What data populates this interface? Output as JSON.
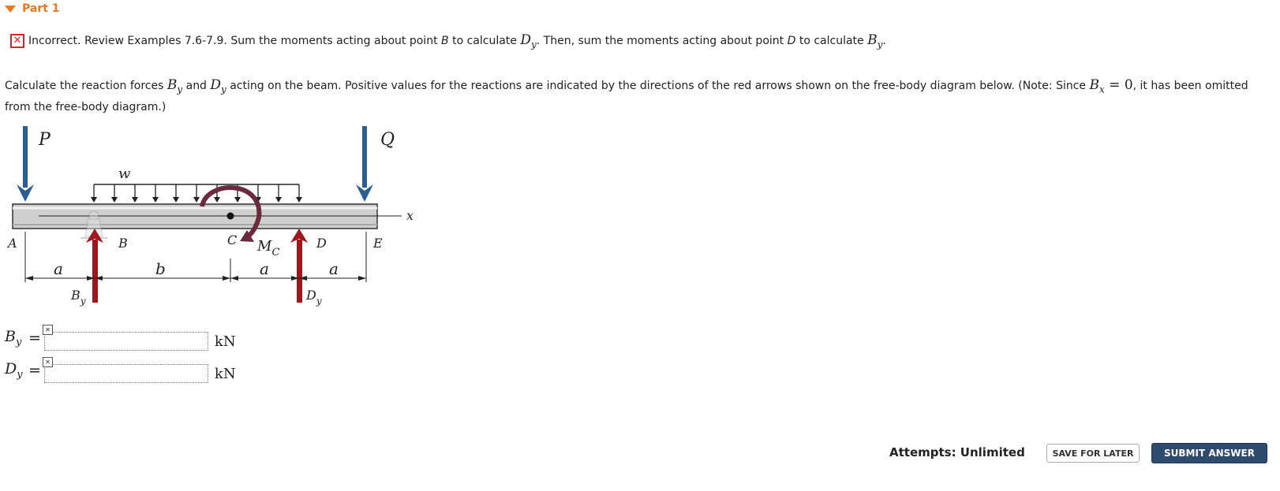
{
  "part": {
    "title": "Part 1"
  },
  "feedback": {
    "status_label": "Incorrect.",
    "review_text": "Review Examples 7.6-7.9.",
    "text_a": "Sum the moments acting about point",
    "point_b": "B",
    "text_b": "to calculate",
    "dy_base": "D",
    "dy_sub": "y",
    "text_c": ". Then, sum the moments acting about point",
    "point_d": "D",
    "text_d": "to calculate",
    "by_base": "B",
    "by_sub": "y",
    "text_e": "."
  },
  "question": {
    "text_a": "Calculate the reaction forces",
    "by_base": "B",
    "by_sub": "y",
    "text_and": "and",
    "dy_base": "D",
    "dy_sub": "y",
    "text_b": "acting on the beam. Positive values for the reactions are indicated by the directions of the red arrows shown on the free-body diagram below. (Note: Since",
    "bx_base": "B",
    "bx_sub": "x",
    "bx_eq": "= 0",
    "text_c": ", it has been omitted from the free-body diagram.)"
  },
  "diagram": {
    "labels": {
      "P": "P",
      "Q": "Q",
      "w": "w",
      "x": "x",
      "A": "A",
      "B": "B",
      "C": "C",
      "D": "D",
      "E": "E",
      "Mc_base": "M",
      "Mc_sub": "C",
      "a1": "a",
      "b": "b",
      "a2": "a",
      "a3": "a",
      "By_base": "B",
      "By_sub": "y",
      "Dy_base": "D",
      "Dy_sub": "y"
    },
    "colors": {
      "load_arrow": "#2b5f93",
      "reaction_arrow": "#a0161c",
      "moment_arrow": "#6b2a3e",
      "beam": "#cfcfcf"
    }
  },
  "answers": [
    {
      "var_base": "B",
      "var_sub": "y",
      "value": "",
      "unit": "kN"
    },
    {
      "var_base": "D",
      "var_sub": "y",
      "value": "",
      "unit": "kN"
    }
  ],
  "footer": {
    "attempts": "Attempts: Unlimited",
    "save_label": "SAVE FOR LATER",
    "submit_label": "SUBMIT ANSWER"
  }
}
